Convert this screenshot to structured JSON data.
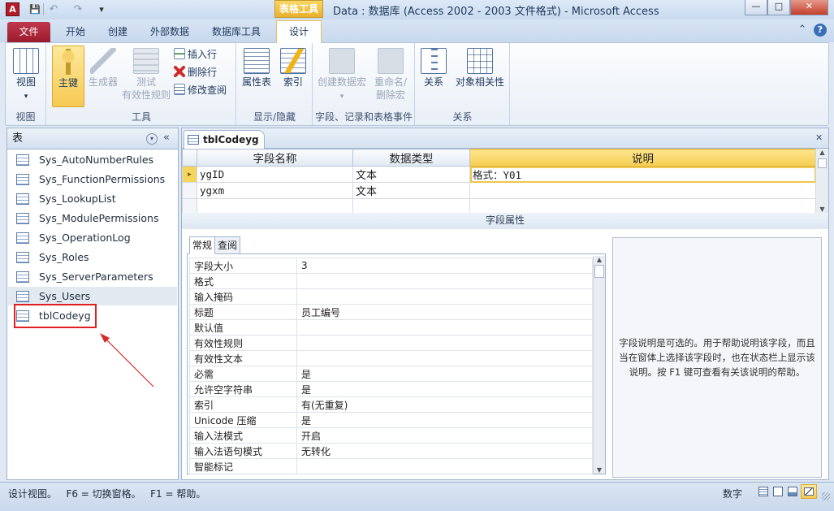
{
  "window": {
    "title": "Data : 数据库 (Access 2002 - 2003 文件格式) - Microsoft Access",
    "contextual_tab": "表格工具",
    "app_icon": "A",
    "controls": {
      "minimize": "—",
      "maximize": "□",
      "close": "✕"
    }
  },
  "quick_access": {
    "save": "💾",
    "undo": "↶",
    "redo": "↷",
    "customize": "▾"
  },
  "tabs": [
    "文件",
    "开始",
    "创建",
    "外部数据",
    "数据库工具",
    "设计"
  ],
  "active_tab": "设计",
  "ribbon": {
    "help": "?",
    "collapse": "⌃",
    "groups": [
      {
        "label": "视图",
        "buttons": [
          "视图"
        ]
      },
      {
        "label": "工具",
        "buttons": [
          "主键",
          "生成器",
          "测试",
          "有效性规则"
        ],
        "small": [
          "插入行",
          "删除行",
          "修改查阅"
        ]
      },
      {
        "label": "显示/隐藏",
        "buttons": [
          "属性表",
          "索引"
        ]
      },
      {
        "label": "字段、记录和表格事件",
        "buttons": [
          "创建数据宏",
          "重命名/",
          "删除宏"
        ]
      },
      {
        "label": "关系",
        "buttons": [
          "关系",
          "对象相关性"
        ]
      }
    ]
  },
  "nav": {
    "header": "表",
    "items": [
      "Sys_AutoNumberRules",
      "Sys_FunctionPermissions",
      "Sys_LookupList",
      "Sys_ModulePermissions",
      "Sys_OperationLog",
      "Sys_Roles",
      "Sys_ServerParameters",
      "Sys_Users",
      "tblCodeyg"
    ],
    "selected": "tblCodeyg"
  },
  "document": {
    "tab_title": "tblCodeyg",
    "close": "✕",
    "columns": [
      "字段名称",
      "数据类型",
      "说明"
    ],
    "rows": [
      {
        "name": "ygID",
        "type": "文本",
        "desc": "格式：Y01"
      },
      {
        "name": "ygxm",
        "type": "文本",
        "desc": ""
      }
    ],
    "field_properties_label": "字段属性",
    "property_tabs": [
      "常规",
      "查阅"
    ],
    "properties": [
      {
        "k": "字段大小",
        "v": "3"
      },
      {
        "k": "格式",
        "v": ""
      },
      {
        "k": "输入掩码",
        "v": ""
      },
      {
        "k": "标题",
        "v": "员工编号"
      },
      {
        "k": "默认值",
        "v": ""
      },
      {
        "k": "有效性规则",
        "v": ""
      },
      {
        "k": "有效性文本",
        "v": ""
      },
      {
        "k": "必需",
        "v": "是"
      },
      {
        "k": "允许空字符串",
        "v": "是"
      },
      {
        "k": "索引",
        "v": "有(无重复)"
      },
      {
        "k": "Unicode 压缩",
        "v": "是"
      },
      {
        "k": "输入法模式",
        "v": "开启"
      },
      {
        "k": "输入法语句模式",
        "v": "无转化"
      },
      {
        "k": "智能标记",
        "v": ""
      }
    ],
    "help_text": "字段说明是可选的。用于帮助说明该字段，而且当在窗体上选择该字段时，也在状态栏上显示该说明。按 F1 键可查看有关该说明的帮助。"
  },
  "status": {
    "left": "设计视图。   F6 = 切换窗格。   F1 = 帮助。",
    "mode": "数字"
  },
  "colors": {
    "accent": "#e9b02b",
    "file_tab": "#b0283d",
    "highlight": "#e02020",
    "selection": "#fdf6c9"
  }
}
